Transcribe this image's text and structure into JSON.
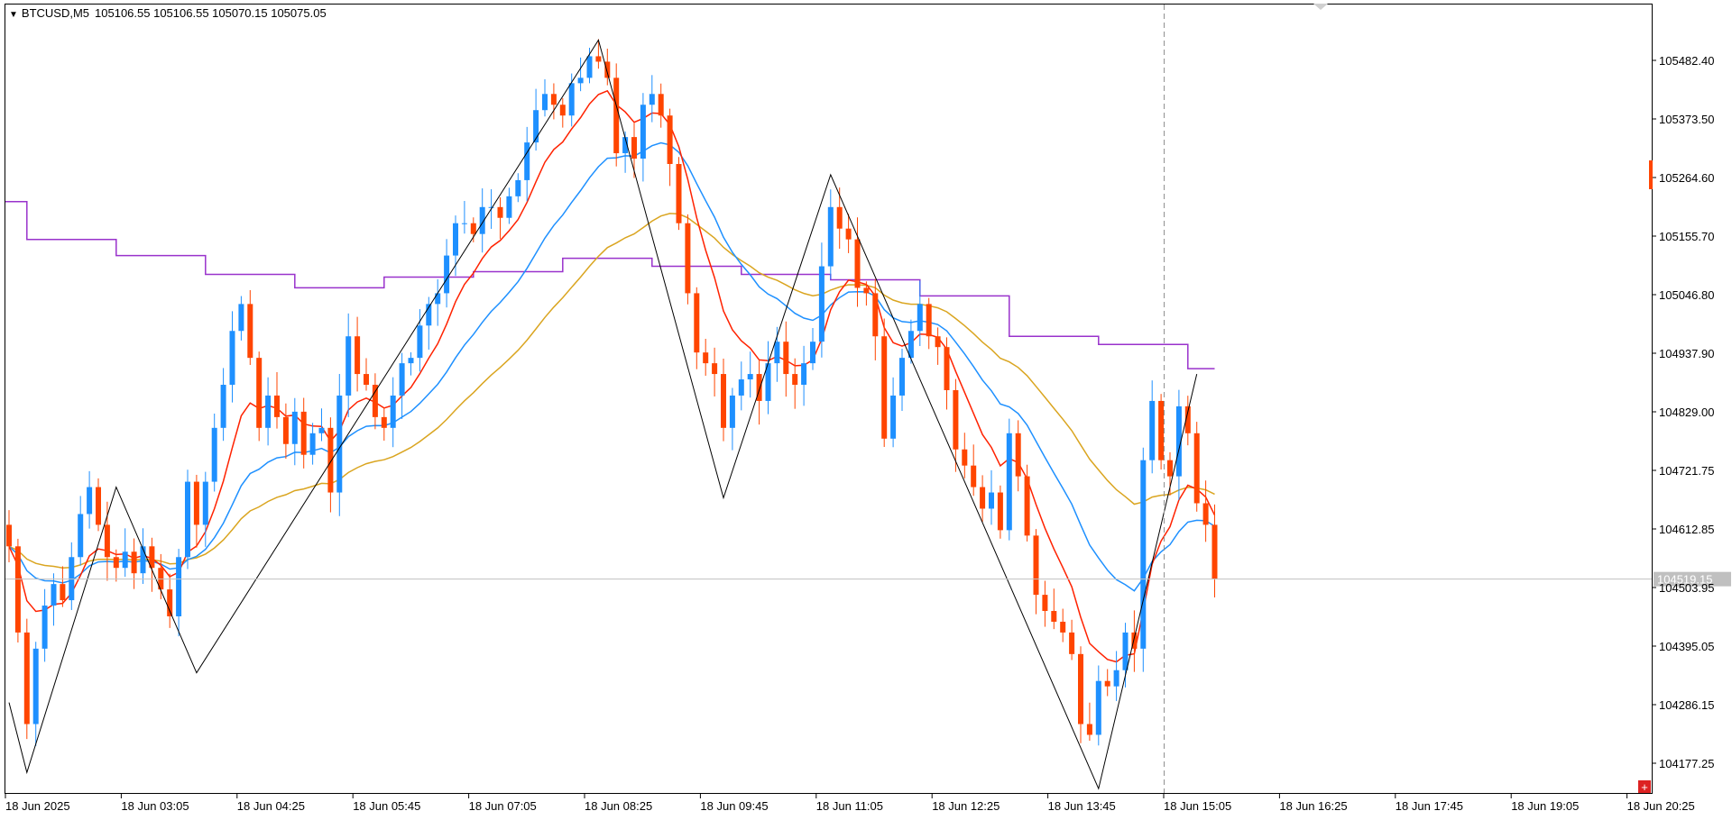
{
  "header": {
    "symbol": "BTCUSD,M5",
    "ohlc": "105106.55 105106.55 105070.15 105075.05"
  },
  "chart_data": {
    "type": "candlestick",
    "symbol": "BTCUSD",
    "timeframe": "M5",
    "ylim": [
      104100,
      105600
    ],
    "y_ticks": [
      "105482.40",
      "105373.50",
      "105264.60",
      "105155.70",
      "105046.80",
      "104937.90",
      "104829.00",
      "104721.75",
      "104612.85",
      "104503.95",
      "104395.05",
      "104286.15",
      "104177.25"
    ],
    "x_ticks": [
      "18 Jun 2025",
      "18 Jun 03:05",
      "18 Jun 04:25",
      "18 Jun 05:45",
      "18 Jun 07:05",
      "18 Jun 08:25",
      "18 Jun 09:45",
      "18 Jun 11:05",
      "18 Jun 12:25",
      "18 Jun 13:45",
      "18 Jun 15:05",
      "18 Jun 16:25",
      "18 Jun 17:45",
      "18 Jun 19:05",
      "18 Jun 20:25"
    ],
    "current_price": 104519.15,
    "current_price_label": "104519.15",
    "colors": {
      "up": "#1e90ff",
      "down": "#ff4500",
      "ma_fast": "#ff2200",
      "ma_mid": "#1e90ff",
      "ma_slow": "#daa520",
      "step": "#9932cc",
      "zigzag": "#000000",
      "price_line": "#c0c0c0"
    },
    "candles_close": [
      104580,
      104420,
      104250,
      104390,
      104470,
      104510,
      104480,
      104560,
      104640,
      104690,
      104620,
      104560,
      104540,
      104570,
      104530,
      104580,
      104540,
      104500,
      104450,
      104560,
      104700,
      104620,
      104700,
      104800,
      104880,
      104980,
      105030,
      104930,
      104800,
      104860,
      104820,
      104770,
      104830,
      104750,
      104790,
      104800,
      104680,
      104860,
      104970,
      104900,
      104880,
      104820,
      104800,
      104860,
      104920,
      104930,
      104990,
      105030,
      105050,
      105120,
      105180,
      105180,
      105160,
      105210,
      105210,
      105190,
      105230,
      105260,
      105330,
      105390,
      105420,
      105400,
      105380,
      105440,
      105450,
      105490,
      105480,
      105450,
      105310,
      105340,
      105300,
      105400,
      105420,
      105380,
      105290,
      105180,
      105050,
      104940,
      104920,
      104900,
      104800,
      104860,
      104890,
      104900,
      104850,
      104920,
      104960,
      104900,
      104880,
      104920,
      104960,
      105100,
      105210,
      105170,
      105150,
      105060,
      105050,
      104970,
      104780,
      104860,
      104930,
      104980,
      105030,
      104970,
      104950,
      104870,
      104760,
      104730,
      104690,
      104650,
      104680,
      104610,
      104790,
      104710,
      104600,
      104490,
      104460,
      104440,
      104420,
      104380,
      104250,
      104230,
      104330,
      104320,
      104350,
      104420,
      104390,
      104740,
      104850,
      104740,
      104710,
      104840,
      104790,
      104660,
      104620,
      104520
    ],
    "zigzag_points": [
      {
        "i": 0,
        "price": 104290
      },
      {
        "i": 2,
        "price": 104160
      },
      {
        "i": 12,
        "price": 104690
      },
      {
        "i": 21,
        "price": 104345
      },
      {
        "i": 66,
        "price": 105520
      },
      {
        "i": 80,
        "price": 104670
      },
      {
        "i": 92,
        "price": 105270
      },
      {
        "i": 122,
        "price": 104130
      },
      {
        "i": 133,
        "price": 104900
      }
    ],
    "step_segments": [
      {
        "from": 0,
        "to": 2,
        "value": 105220
      },
      {
        "from": 2,
        "to": 12,
        "value": 105150
      },
      {
        "from": 12,
        "to": 22,
        "value": 105120
      },
      {
        "from": 22,
        "to": 32,
        "value": 105085
      },
      {
        "from": 32,
        "to": 42,
        "value": 105060
      },
      {
        "from": 42,
        "to": 52,
        "value": 105080
      },
      {
        "from": 52,
        "to": 62,
        "value": 105090
      },
      {
        "from": 62,
        "to": 72,
        "value": 105115
      },
      {
        "from": 72,
        "to": 82,
        "value": 105100
      },
      {
        "from": 82,
        "to": 92,
        "value": 105085
      },
      {
        "from": 92,
        "to": 102,
        "value": 105075
      },
      {
        "from": 102,
        "to": 112,
        "value": 105045
      },
      {
        "from": 112,
        "to": 122,
        "value": 104970
      },
      {
        "from": 122,
        "to": 132,
        "value": 104955
      },
      {
        "from": 132,
        "to": 135,
        "value": 104910
      }
    ]
  }
}
